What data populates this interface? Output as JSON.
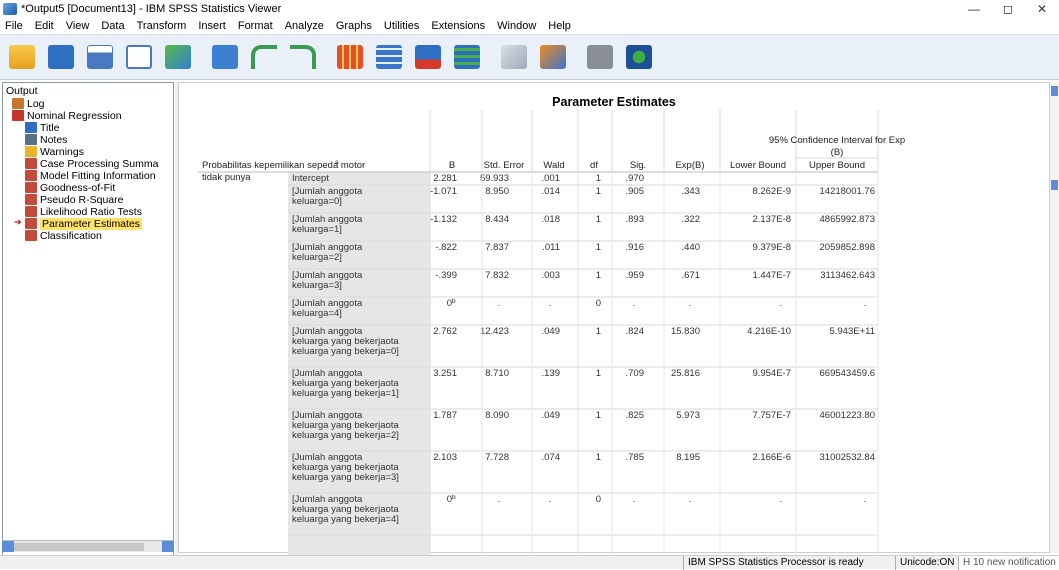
{
  "window": {
    "title": "*Output5 [Document13] - IBM SPSS Statistics Viewer",
    "minimize": "—",
    "maximize": "◻",
    "close": "✕"
  },
  "menu": [
    "File",
    "Edit",
    "View",
    "Data",
    "Transform",
    "Insert",
    "Format",
    "Analyze",
    "Graphs",
    "Utilities",
    "Extensions",
    "Window",
    "Help"
  ],
  "toolbar_icons": [
    "open-folder-icon",
    "save-icon",
    "print-icon",
    "print-preview-icon",
    "export-icon",
    "recall-dialog-icon",
    "undo-icon",
    "redo-icon",
    "goto-data-icon",
    "goto-case-icon",
    "goto-variable-icon",
    "variables-icon",
    "split-file-icon",
    "weight-cases-icon",
    "select-cases-icon",
    "designate-window-icon"
  ],
  "outline": {
    "root": "Output",
    "items": [
      {
        "label": "Log",
        "level": 0,
        "icon": "log"
      },
      {
        "label": "Nominal Regression",
        "level": 0,
        "icon": "folder"
      },
      {
        "label": "Title",
        "level": 1,
        "icon": "title"
      },
      {
        "label": "Notes",
        "level": 1,
        "icon": "notes"
      },
      {
        "label": "Warnings",
        "level": 1,
        "icon": "warning"
      },
      {
        "label": "Case Processing Summa",
        "level": 1,
        "icon": "table"
      },
      {
        "label": "Model Fitting Information",
        "level": 1,
        "icon": "table"
      },
      {
        "label": "Goodness-of-Fit",
        "level": 1,
        "icon": "table"
      },
      {
        "label": "Pseudo R-Square",
        "level": 1,
        "icon": "table"
      },
      {
        "label": "Likelihood Ratio Tests",
        "level": 1,
        "icon": "table"
      },
      {
        "label": "Parameter Estimates",
        "level": 1,
        "icon": "table",
        "selected": true
      },
      {
        "label": "Classification",
        "level": 1,
        "icon": "table"
      }
    ]
  },
  "table": {
    "title": "Parameter Estimates",
    "ci_header": "95% Confidence Interval for Exp (B)",
    "dep_header": "Probabilitas kepemilikan sepeda motor",
    "dep_sup": "a",
    "columns": [
      "B",
      "Std. Error",
      "Wald",
      "df",
      "Sig.",
      "Exp(B)",
      "Lower Bound",
      "Upper Bound"
    ],
    "group": "tidak punya",
    "rows": [
      {
        "label": "Intercept",
        "B": "2.281",
        "sup": "",
        "se": "59.933",
        "wald": ".001",
        "df": "1",
        "sig": ".970",
        "exp": "",
        "lb": "",
        "ub": ""
      },
      {
        "label": "[Jumlah anggota keluarga=0]",
        "B": "-1.071",
        "sup": "",
        "se": "8.950",
        "wald": ".014",
        "df": "1",
        "sig": ".905",
        "exp": ".343",
        "lb": "8.262E-9",
        "ub": "14218001.76"
      },
      {
        "label": "[Jumlah anggota keluarga=1]",
        "B": "-1.132",
        "sup": "",
        "se": "8.434",
        "wald": ".018",
        "df": "1",
        "sig": ".893",
        "exp": ".322",
        "lb": "2.137E-8",
        "ub": "4865992.873"
      },
      {
        "label": "[Jumlah anggota keluarga=2]",
        "B": "-.822",
        "sup": "",
        "se": "7.837",
        "wald": ".011",
        "df": "1",
        "sig": ".916",
        "exp": ".440",
        "lb": "9.379E-8",
        "ub": "2059852.898"
      },
      {
        "label": "[Jumlah anggota keluarga=3]",
        "B": "-.399",
        "sup": "",
        "se": "7.832",
        "wald": ".003",
        "df": "1",
        "sig": ".959",
        "exp": ".671",
        "lb": "1.447E-7",
        "ub": "3113462.643"
      },
      {
        "label": "[Jumlah anggota keluarga=4]",
        "B": "0",
        "sup": "b",
        "se": ".",
        "wald": ".",
        "df": "0",
        "sig": ".",
        "exp": ".",
        "lb": ".",
        "ub": "."
      },
      {
        "label": "[Jumlah anggota keluarga yang bekerjaota keluarga yang bekerja=0]",
        "B": "2.762",
        "sup": "",
        "se": "12.423",
        "wald": ".049",
        "df": "1",
        "sig": ".824",
        "exp": "15.830",
        "lb": "4.216E-10",
        "ub": "5.943E+11"
      },
      {
        "label": "[Jumlah anggota keluarga yang bekerjaota keluarga yang bekerja=1]",
        "B": "3.251",
        "sup": "",
        "se": "8.710",
        "wald": ".139",
        "df": "1",
        "sig": ".709",
        "exp": "25.816",
        "lb": "9.954E-7",
        "ub": "669543459.6"
      },
      {
        "label": "[Jumlah anggota keluarga yang bekerjaota keluarga yang bekerja=2]",
        "B": "1.787",
        "sup": "",
        "se": "8.090",
        "wald": ".049",
        "df": "1",
        "sig": ".825",
        "exp": "5.973",
        "lb": "7.757E-7",
        "ub": "46001223.80"
      },
      {
        "label": "[Jumlah anggota keluarga yang bekerjaota keluarga yang bekerja=3]",
        "B": "2.103",
        "sup": "",
        "se": "7.728",
        "wald": ".074",
        "df": "1",
        "sig": ".785",
        "exp": "8.195",
        "lb": "2.166E-6",
        "ub": "31002532.84"
      },
      {
        "label": "[Jumlah anggota keluarga yang bekerjaota keluarga yang bekerja=4]",
        "B": "0",
        "sup": "b",
        "se": ".",
        "wald": ".",
        "df": "0",
        "sig": ".",
        "exp": ".",
        "lb": ".",
        "ub": "."
      }
    ]
  },
  "status": {
    "processor": "IBM SPSS Statistics Processor is ready",
    "unicode": "Unicode:ON",
    "notifications": "H 10 new notification"
  },
  "colors": {
    "toolbar_bg": "#eaf0f7",
    "label_cell_bg": "#e6e6e6",
    "selected_bg": "#ffe36b"
  }
}
